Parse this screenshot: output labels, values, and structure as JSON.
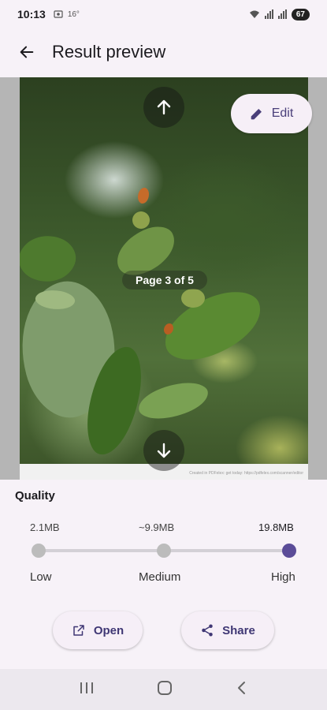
{
  "status_bar": {
    "time": "10:13",
    "temp": "16°",
    "battery": "67"
  },
  "app_bar": {
    "title": "Result preview"
  },
  "preview": {
    "page_label": "Page 3 of 5",
    "edit_label": "Edit",
    "watermark": "Created in PDFelex: get today: https://pdfelex.com/scanner/editor"
  },
  "quality": {
    "title": "Quality",
    "sizes": [
      "2.1MB",
      "~9.9MB",
      "19.8MB"
    ],
    "levels": [
      "Low",
      "Medium",
      "High"
    ],
    "selected": "High"
  },
  "actions": {
    "open_label": "Open",
    "share_label": "Share"
  },
  "colors": {
    "accent": "#5b4c98",
    "button_bg": "#f6eff7"
  }
}
